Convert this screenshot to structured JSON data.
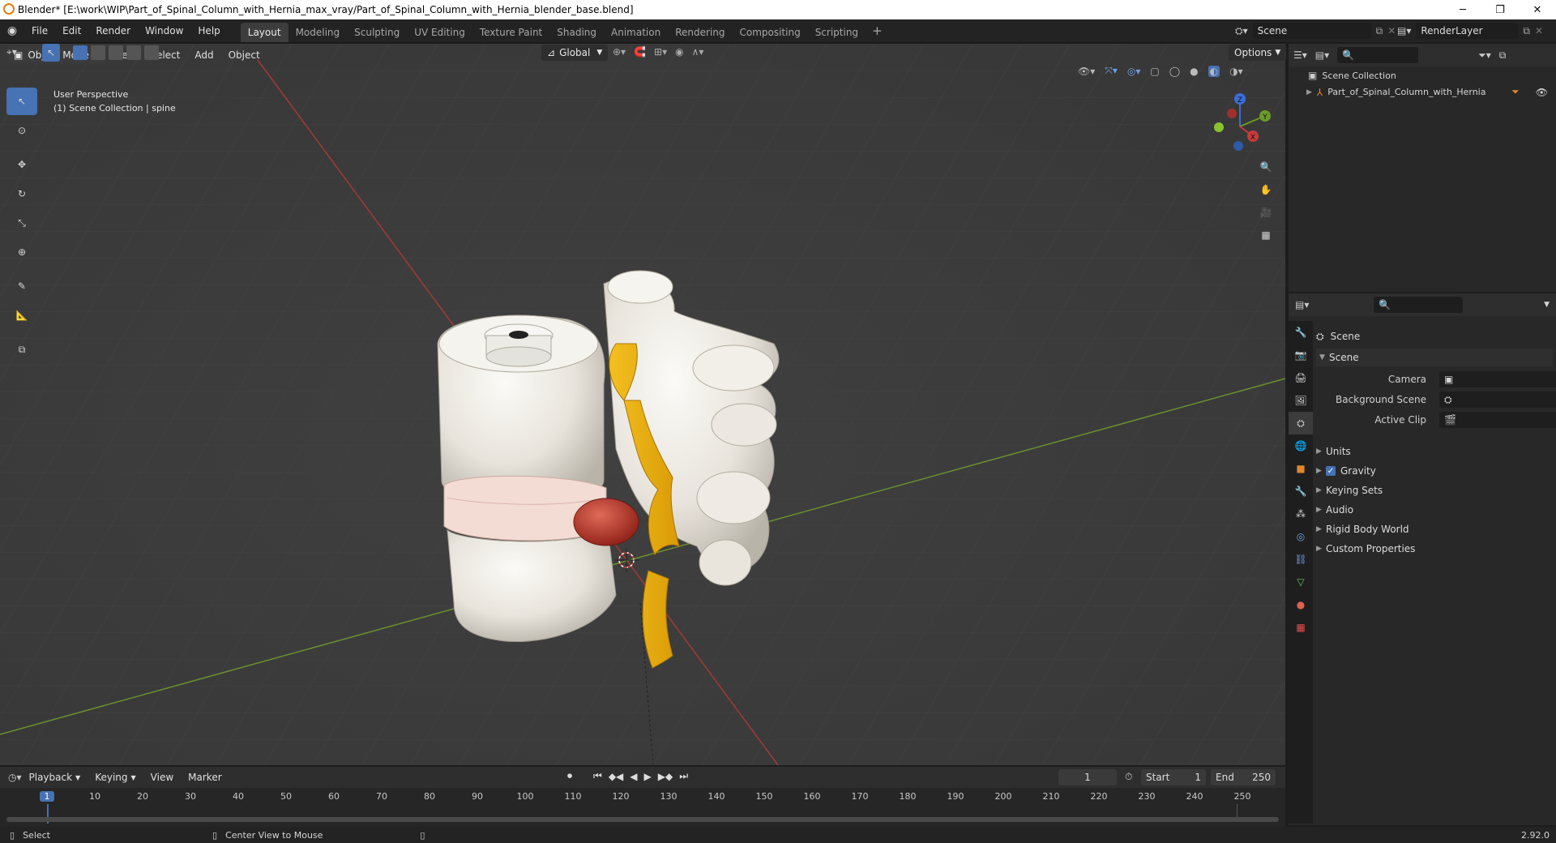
{
  "window": {
    "title": "Blender* [E:\\work\\WIP\\Part_of_Spinal_Column_with_Hernia_max_vray/Part_of_Spinal_Column_with_Hernia_blender_base.blend]"
  },
  "menus": [
    "File",
    "Edit",
    "Render",
    "Window",
    "Help"
  ],
  "workspaces": [
    "Layout",
    "Modeling",
    "Sculpting",
    "UV Editing",
    "Texture Paint",
    "Shading",
    "Animation",
    "Rendering",
    "Compositing",
    "Scripting"
  ],
  "active_workspace": "Layout",
  "scene_name": "Scene",
  "render_layer": "RenderLayer",
  "viewport": {
    "mode": "Object Mode",
    "menus": [
      "View",
      "Select",
      "Add",
      "Object"
    ],
    "transform_orientation": "Global",
    "options_label": "Options",
    "overlay_line1": "User Perspective",
    "overlay_line2": "(1) Scene Collection | spine",
    "axes": {
      "x": "X",
      "y": "Y",
      "z": "Z"
    }
  },
  "outliner": {
    "collection": "Scene Collection",
    "object": "Part_of_Spinal_Column_with_Hernia"
  },
  "properties": {
    "header": "Scene",
    "panel": "Scene",
    "fields": [
      {
        "label": "Camera",
        "value": ""
      },
      {
        "label": "Background Scene",
        "value": ""
      },
      {
        "label": "Active Clip",
        "value": ""
      }
    ],
    "subpanels": [
      "Units",
      "Gravity",
      "Keying Sets",
      "Audio",
      "Rigid Body World",
      "Custom Properties"
    ],
    "gravity_checked": true
  },
  "timeline": {
    "menus": [
      "Playback",
      "Keying",
      "View",
      "Marker"
    ],
    "current_frame": "1",
    "start_label": "Start",
    "start": "1",
    "end_label": "End",
    "end": "250",
    "ticks": [
      "1",
      "10",
      "20",
      "30",
      "40",
      "50",
      "60",
      "70",
      "80",
      "90",
      "100",
      "110",
      "120",
      "130",
      "140",
      "150",
      "160",
      "170",
      "180",
      "190",
      "200",
      "210",
      "220",
      "230",
      "240",
      "250"
    ]
  },
  "status": {
    "left": "Select",
    "middle": "Center View to Mouse",
    "version": "2.92.0"
  },
  "colors": {
    "accent": "#4772b3",
    "x_axis": "#c83a3a",
    "y_axis": "#6a9a2a",
    "z_axis": "#3a6ed8",
    "frame": "#4772b3"
  }
}
